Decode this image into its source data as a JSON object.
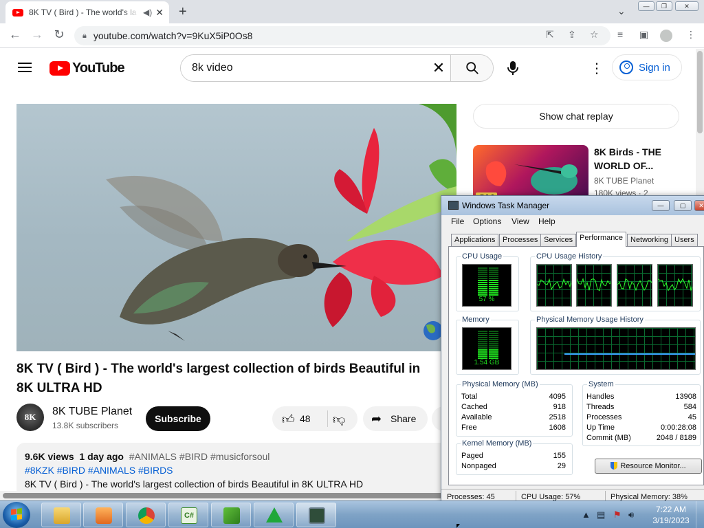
{
  "browser": {
    "tab": {
      "title": "8K TV ( Bird ) - The world's la",
      "audio_icon": "speaker-icon",
      "close_glyph": "✕"
    },
    "new_tab_glyph": "+",
    "tab_search_glyph": "⌄",
    "window_controls": {
      "minimize": "—",
      "restore": "❐",
      "close": "✕"
    },
    "nav": {
      "back": "←",
      "forward": "→",
      "reload": "↻"
    },
    "url": "youtube.com/watch?v=9KuX5iP0Os8"
  },
  "youtube": {
    "logo_text": "YouTube",
    "search": {
      "value": "8k video",
      "clear_glyph": "✕",
      "search_glyph": "⌕"
    },
    "kebab_glyph": "⋮",
    "signin_label": "Sign in",
    "video": {
      "title": "8K TV ( Bird ) - The world's largest collection of birds Beautiful in 8K ULTRA HD",
      "channel_name": "8K TUBE Planet",
      "channel_avatar_text": "8K",
      "subscribers": "13.8K subscribers",
      "subscribe_label": "Subscribe",
      "like_count": "48",
      "share_label": "Share"
    },
    "description": {
      "views": "9.6K views",
      "date": "1 day ago",
      "hashtags_line1": "#ANIMALS #BIRD #musicforsoul",
      "hashtags_line2": "#8KZK #BIRD #ANIMALS #BIRDS",
      "text": "8K TV ( Bird ) - The world's largest collection of birds Beautiful in 8K ULTRA HD"
    },
    "chat_replay_label": "Show chat replay",
    "recommendation": {
      "title": "8K Birds - THE WORLD OF...",
      "channel": "8K TUBE Planet",
      "views": "180K views · 2",
      "badge": "8K"
    }
  },
  "task_manager": {
    "title": "Windows Task Manager",
    "menu": [
      "File",
      "Options",
      "View",
      "Help"
    ],
    "tabs": [
      "Applications",
      "Processes",
      "Services",
      "Performance",
      "Networking",
      "Users"
    ],
    "active_tab": "Performance",
    "cpu_usage_label": "CPU Usage",
    "cpu_usage_value": "57 %",
    "cpu_usage_fraction": 0.57,
    "cpu_history_label": "CPU Usage History",
    "memory_label": "Memory",
    "memory_value": "1.54 GB",
    "memory_fraction": 0.38,
    "memory_history_label": "Physical Memory Usage History",
    "physical_memory": {
      "label": "Physical Memory (MB)",
      "rows": [
        {
          "name": "Total",
          "value": "4095"
        },
        {
          "name": "Cached",
          "value": "918"
        },
        {
          "name": "Available",
          "value": "2518"
        },
        {
          "name": "Free",
          "value": "1608"
        }
      ]
    },
    "system": {
      "label": "System",
      "rows": [
        {
          "name": "Handles",
          "value": "13908"
        },
        {
          "name": "Threads",
          "value": "584"
        },
        {
          "name": "Processes",
          "value": "45"
        },
        {
          "name": "Up Time",
          "value": "0:00:28:08"
        },
        {
          "name": "Commit (MB)",
          "value": "2048 / 8189"
        }
      ]
    },
    "kernel_memory": {
      "label": "Kernel Memory (MB)",
      "rows": [
        {
          "name": "Paged",
          "value": "155"
        },
        {
          "name": "Nonpaged",
          "value": "29"
        }
      ]
    },
    "resource_monitor_label": "Resource Monitor...",
    "status": {
      "processes": "Processes: 45",
      "cpu": "CPU Usage: 57%",
      "memory": "Physical Memory: 38%"
    }
  },
  "taskbar": {
    "items": [
      "explorer-icon",
      "media-player-icon",
      "chrome-icon",
      "csharp-icon",
      "registry-icon",
      "green-triangle-icon",
      "task-manager-icon"
    ],
    "time": "7:22 AM",
    "date": "3/19/2023",
    "colors": {
      "start": "#1a5da8",
      "chrome_red": "#db4437",
      "chrome_green": "#0f9d58",
      "chrome_yellow": "#f4b400"
    }
  }
}
